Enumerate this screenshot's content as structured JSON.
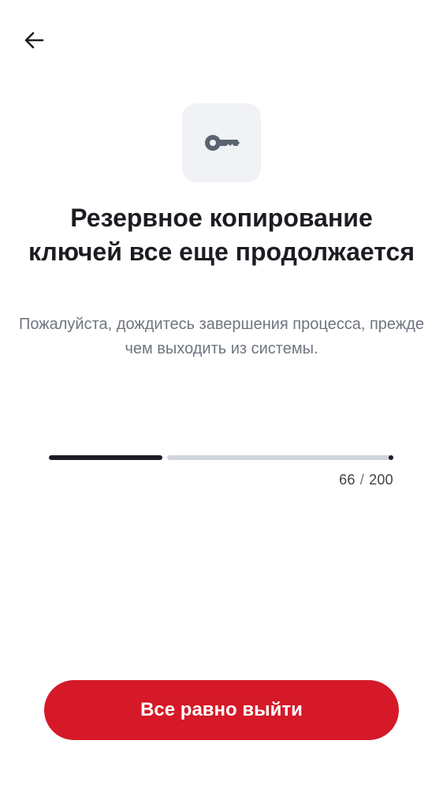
{
  "header": {
    "back_icon": "arrow-left-icon"
  },
  "hero": {
    "icon": "key-icon",
    "title": "Резервное копирование ключей все еще продолжается",
    "subtitle": "Пожалуйста, дождитесь завершения процесса, прежде чем выходить из системы."
  },
  "progress": {
    "current": 66,
    "total": 200,
    "current_label": "66",
    "separator": "/",
    "total_label": "200"
  },
  "actions": {
    "exit_label": "Все равно выйти"
  },
  "colors": {
    "primary_text": "#1b1d22",
    "secondary_text": "#6f7580",
    "icon_tile_bg": "#f0f2f5",
    "progress_fill": "#1b1d22",
    "progress_track": "#d0d5dd",
    "danger_button": "#d51928"
  }
}
